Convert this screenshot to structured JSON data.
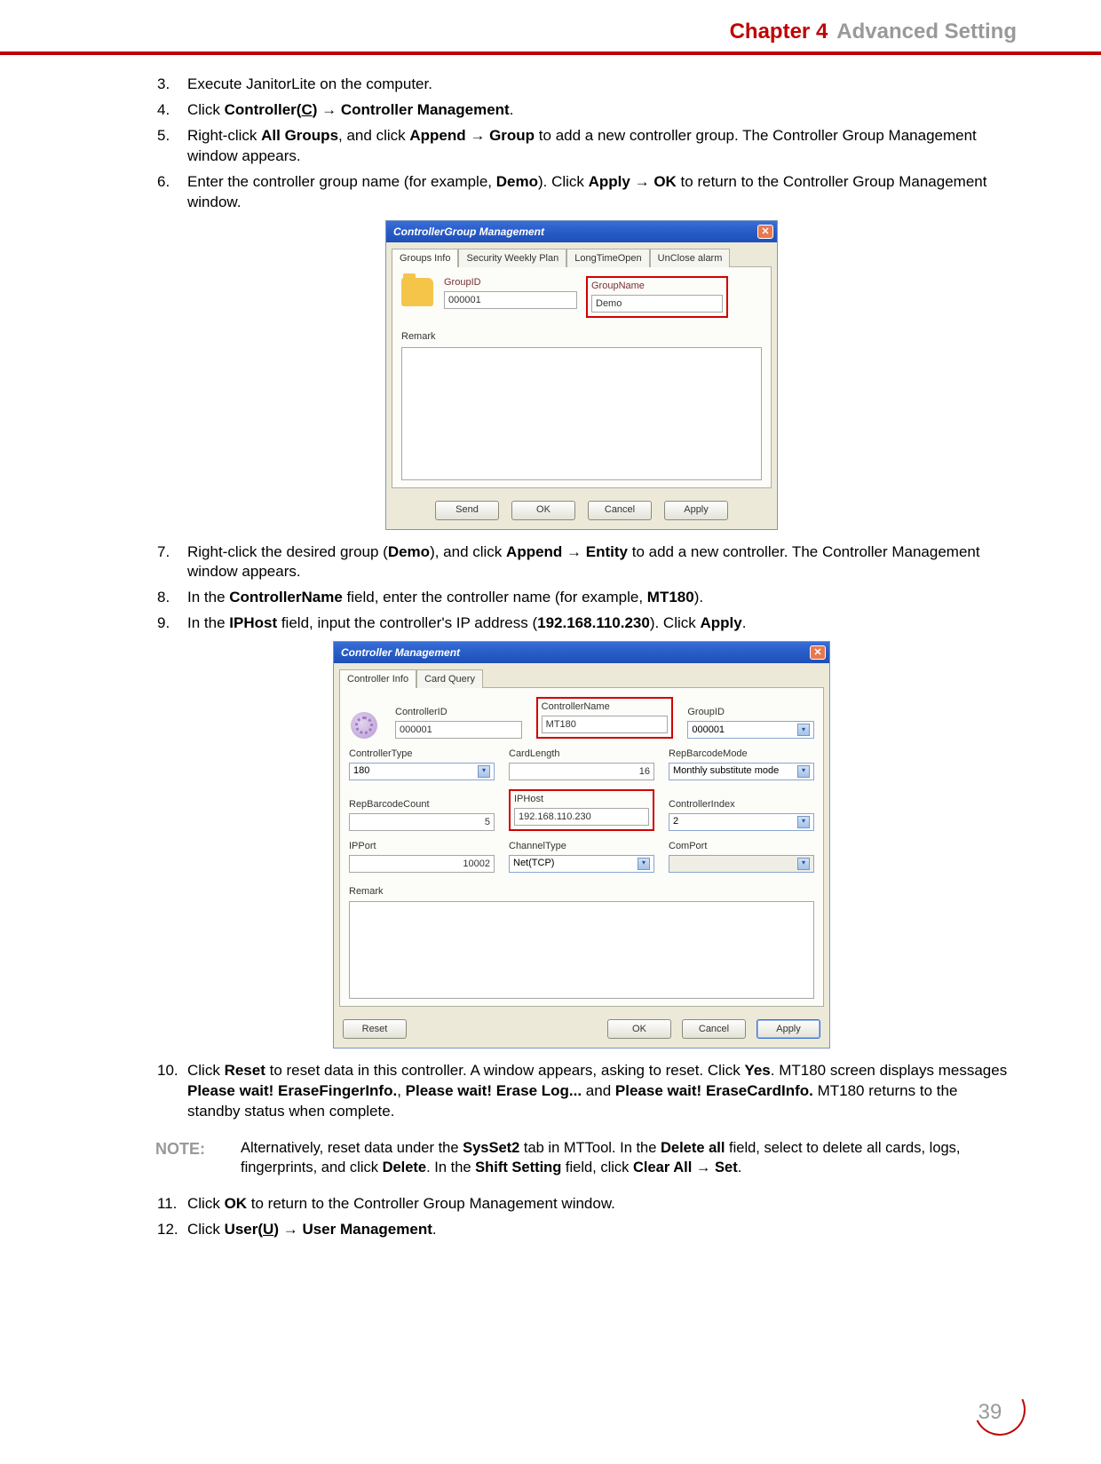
{
  "header": {
    "chapter": "Chapter 4",
    "title": "Advanced Setting"
  },
  "steps_a": [
    {
      "n": "3.",
      "text": "Execute JanitorLite on the computer."
    },
    {
      "n": "4.",
      "pre": "Click ",
      "b1": "Controller(",
      "u": "C",
      "b1b": ")",
      "arrow": " → ",
      "b2": "Controller Management",
      "post": "."
    },
    {
      "n": "5.",
      "pre": "Right-click ",
      "b1": "All Groups",
      "mid1": ", and click ",
      "b2": "Append",
      "arrow": " → ",
      "b3": "Group",
      "post": " to add a new controller group. The Controller Group Management window appears."
    },
    {
      "n": "6.",
      "pre": "Enter the controller group name (for example, ",
      "b1": "Demo",
      "mid1": "). Click ",
      "b2": "Apply",
      "arrow": " → ",
      "b3": "OK",
      "post": " to return to the Controller Group Management window."
    }
  ],
  "dlg1": {
    "title": "ControllerGroup Management",
    "tabs": [
      "Groups Info",
      "Security Weekly Plan",
      "LongTimeOpen",
      "UnClose alarm"
    ],
    "groupid_label": "GroupID",
    "groupid_value": "000001",
    "groupname_label": "GroupName",
    "groupname_value": "Demo",
    "remark_label": "Remark",
    "buttons": {
      "send": "Send",
      "ok": "OK",
      "cancel": "Cancel",
      "apply": "Apply"
    }
  },
  "steps_b": [
    {
      "n": "7.",
      "pre": "Right-click the desired group (",
      "b1": "Demo",
      "mid1": "), and click ",
      "b2": "Append",
      "arrow": " → ",
      "b3": "Entity",
      "post": " to add a new controller. The Controller Management window appears."
    },
    {
      "n": "8.",
      "pre": "In the ",
      "b1": "ControllerName",
      "mid1": " field, enter the controller name (for example, ",
      "b2": "MT180",
      "post": ")."
    },
    {
      "n": "9.",
      "pre": "In the ",
      "b1": "IPHost",
      "mid1": " field, input the controller's IP address (",
      "b2": "192.168.110.230",
      "mid2": "). Click ",
      "b3": "Apply",
      "post": "."
    }
  ],
  "dlg2": {
    "title": "Controller Management",
    "tabs": [
      "Controller Info",
      "Card Query"
    ],
    "fields": {
      "controllerid": {
        "label": "ControllerID",
        "value": "000001"
      },
      "controllername": {
        "label": "ControllerName",
        "value": "MT180"
      },
      "groupid": {
        "label": "GroupID",
        "value": "000001"
      },
      "controllertype": {
        "label": "ControllerType",
        "value": "180"
      },
      "cardlength": {
        "label": "CardLength",
        "value": "16"
      },
      "repbarcodemode": {
        "label": "RepBarcodeMode",
        "value": "Monthly substitute mode"
      },
      "repbarcodecount": {
        "label": "RepBarcodeCount",
        "value": "5"
      },
      "iphost": {
        "label": "IPHost",
        "value": "192.168.110.230"
      },
      "controllerindex": {
        "label": "ControllerIndex",
        "value": "2"
      },
      "ipport": {
        "label": "IPPort",
        "value": "10002"
      },
      "channeltype": {
        "label": "ChannelType",
        "value": "Net(TCP)"
      },
      "comport": {
        "label": "ComPort",
        "value": ""
      }
    },
    "remark_label": "Remark",
    "buttons": {
      "reset": "Reset",
      "ok": "OK",
      "cancel": "Cancel",
      "apply": "Apply"
    }
  },
  "steps_c": [
    {
      "n": "10.",
      "pre": "Click ",
      "b1": "Reset",
      "mid1": " to reset data in this controller. A window appears, asking to reset. Click ",
      "b2": "Yes",
      "mid2": ". MT180 screen displays messages ",
      "b3": "Please wait! EraseFingerInfo.",
      "mid3": ", ",
      "b4": "Please wait! Erase Log...",
      "mid4": " and ",
      "b5": "Please wait! EraseCardInfo.",
      "post": " MT180 returns to the standby status when complete."
    }
  ],
  "note": {
    "label": "NOTE:",
    "pre": "Alternatively, reset data under the ",
    "b1": "SysSet2",
    "mid1": " tab in MTTool. In the ",
    "b2": "Delete all",
    "mid2": " field, select to delete all cards, logs, fingerprints, and click ",
    "b3": "Delete",
    "mid3": ". In the ",
    "b4": "Shift Setting",
    "mid4": " field, click ",
    "b5": "Clear All",
    "arrow": " → ",
    "b6": "Set",
    "post": "."
  },
  "steps_d": [
    {
      "n": "11.",
      "pre": "Click ",
      "b1": "OK",
      "post": " to return to the Controller Group Management window."
    },
    {
      "n": "12.",
      "pre": "Click ",
      "b1": "User(",
      "u": "U",
      "b1b": ")",
      "arrow": " → ",
      "b2": "User Management",
      "post": "."
    }
  ],
  "page_number": "39"
}
